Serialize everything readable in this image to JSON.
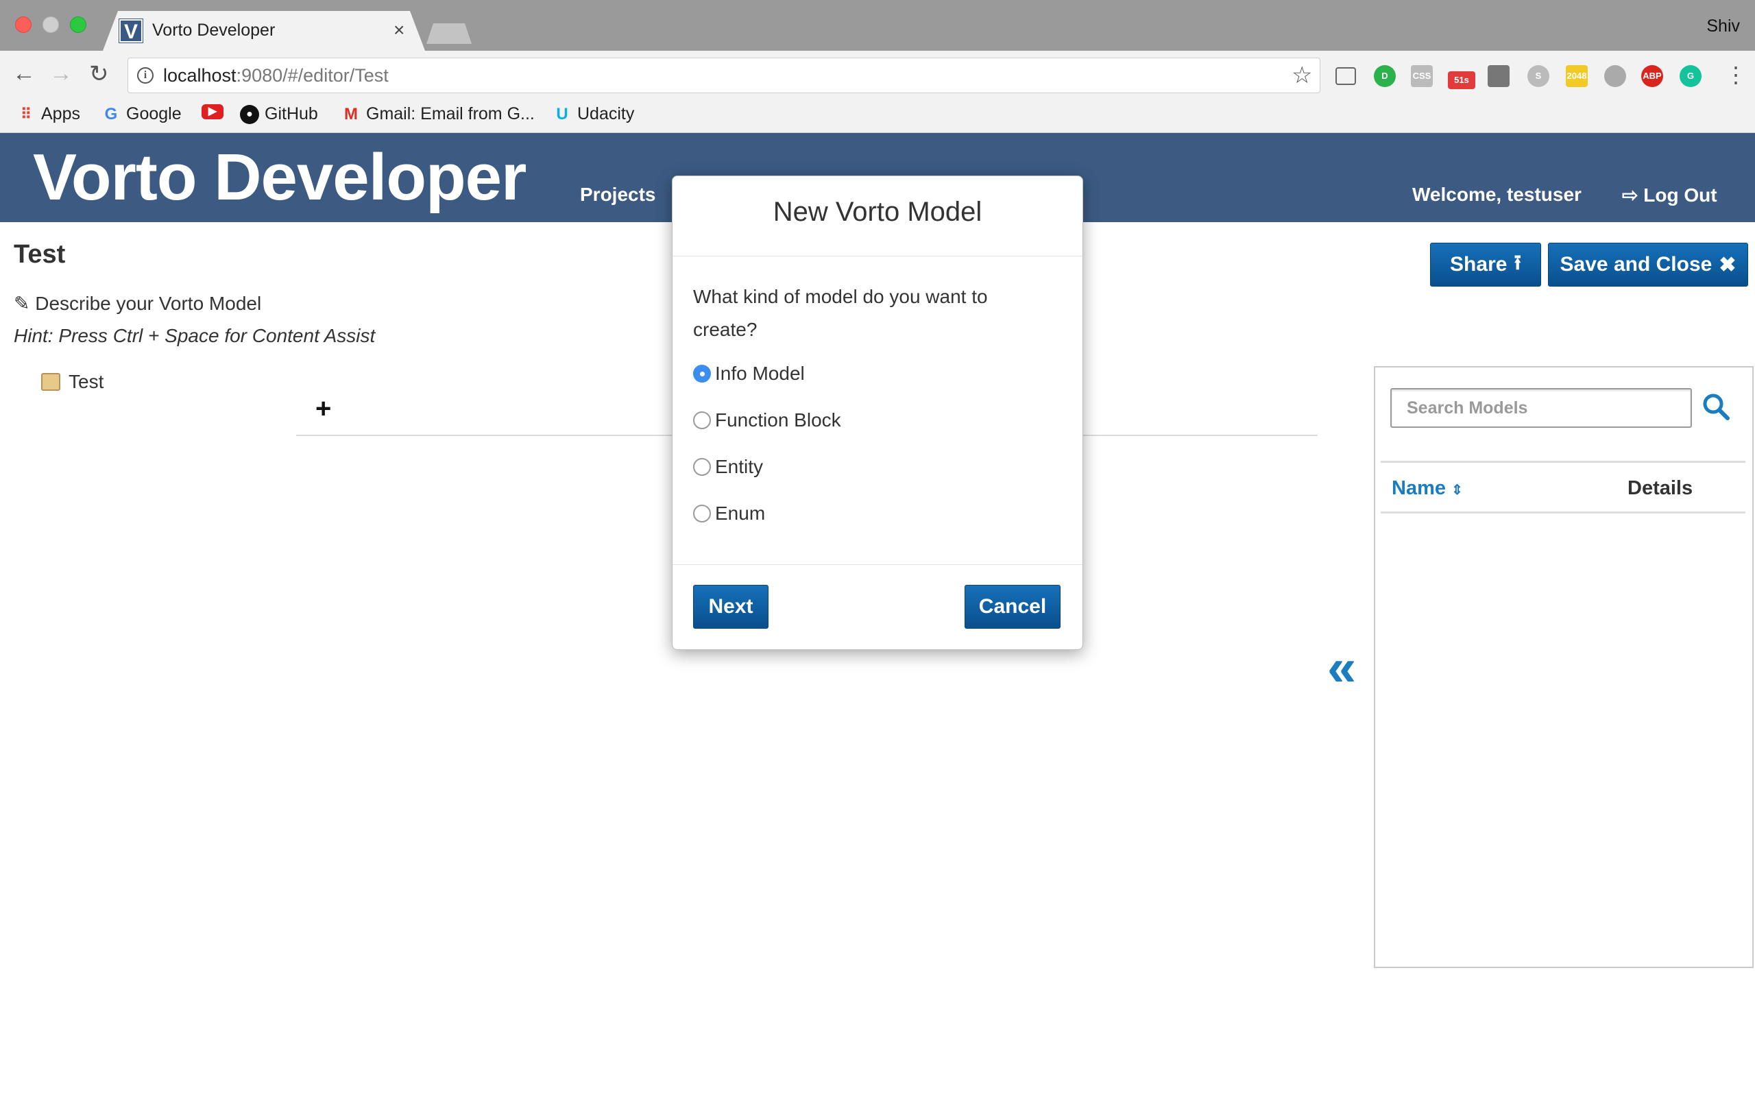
{
  "browser": {
    "tab_title": "Vorto Developer",
    "tab_favicon": "V",
    "profile_name": "Shiv",
    "url_host": "localhost",
    "url_rest": ":9080/#/editor/Test",
    "extension_badge": "51s",
    "extension_abp": "ABP",
    "bookmarks": [
      {
        "label": "Apps",
        "icon": "apps-grid-icon"
      },
      {
        "label": "Google",
        "icon": "google-icon"
      },
      {
        "label": "",
        "icon": "youtube-icon"
      },
      {
        "label": "GitHub",
        "icon": "github-icon"
      },
      {
        "label": "Gmail: Email from G...",
        "icon": "gmail-icon"
      },
      {
        "label": "Udacity",
        "icon": "udacity-icon"
      }
    ]
  },
  "header": {
    "brand": "Vorto Developer",
    "nav_projects": "Projects",
    "welcome": "Welcome, testuser",
    "logout": "Log Out"
  },
  "editor": {
    "title": "Test",
    "describe": "Describe your Vorto Model",
    "hint": "Hint: Press Ctrl + Space for Content Assist",
    "tree_item": "Test",
    "add_symbol": "+"
  },
  "actions": {
    "share": "Share",
    "save_close": "Save and Close"
  },
  "search": {
    "placeholder": "Search Models",
    "col_name": "Name",
    "col_details": "Details"
  },
  "modal": {
    "title": "New Vorto Model",
    "question": "What kind of model do you want to create?",
    "options": [
      {
        "label": "Info Model",
        "selected": true
      },
      {
        "label": "Function Block",
        "selected": false
      },
      {
        "label": "Entity",
        "selected": false
      },
      {
        "label": "Enum",
        "selected": false
      }
    ],
    "next": "Next",
    "cancel": "Cancel"
  },
  "colors": {
    "header_bg": "#3c5a82",
    "button_blue": "#0a4f8e",
    "link_blue": "#1a7cc1",
    "radio_selected": "#3b8ef0"
  }
}
